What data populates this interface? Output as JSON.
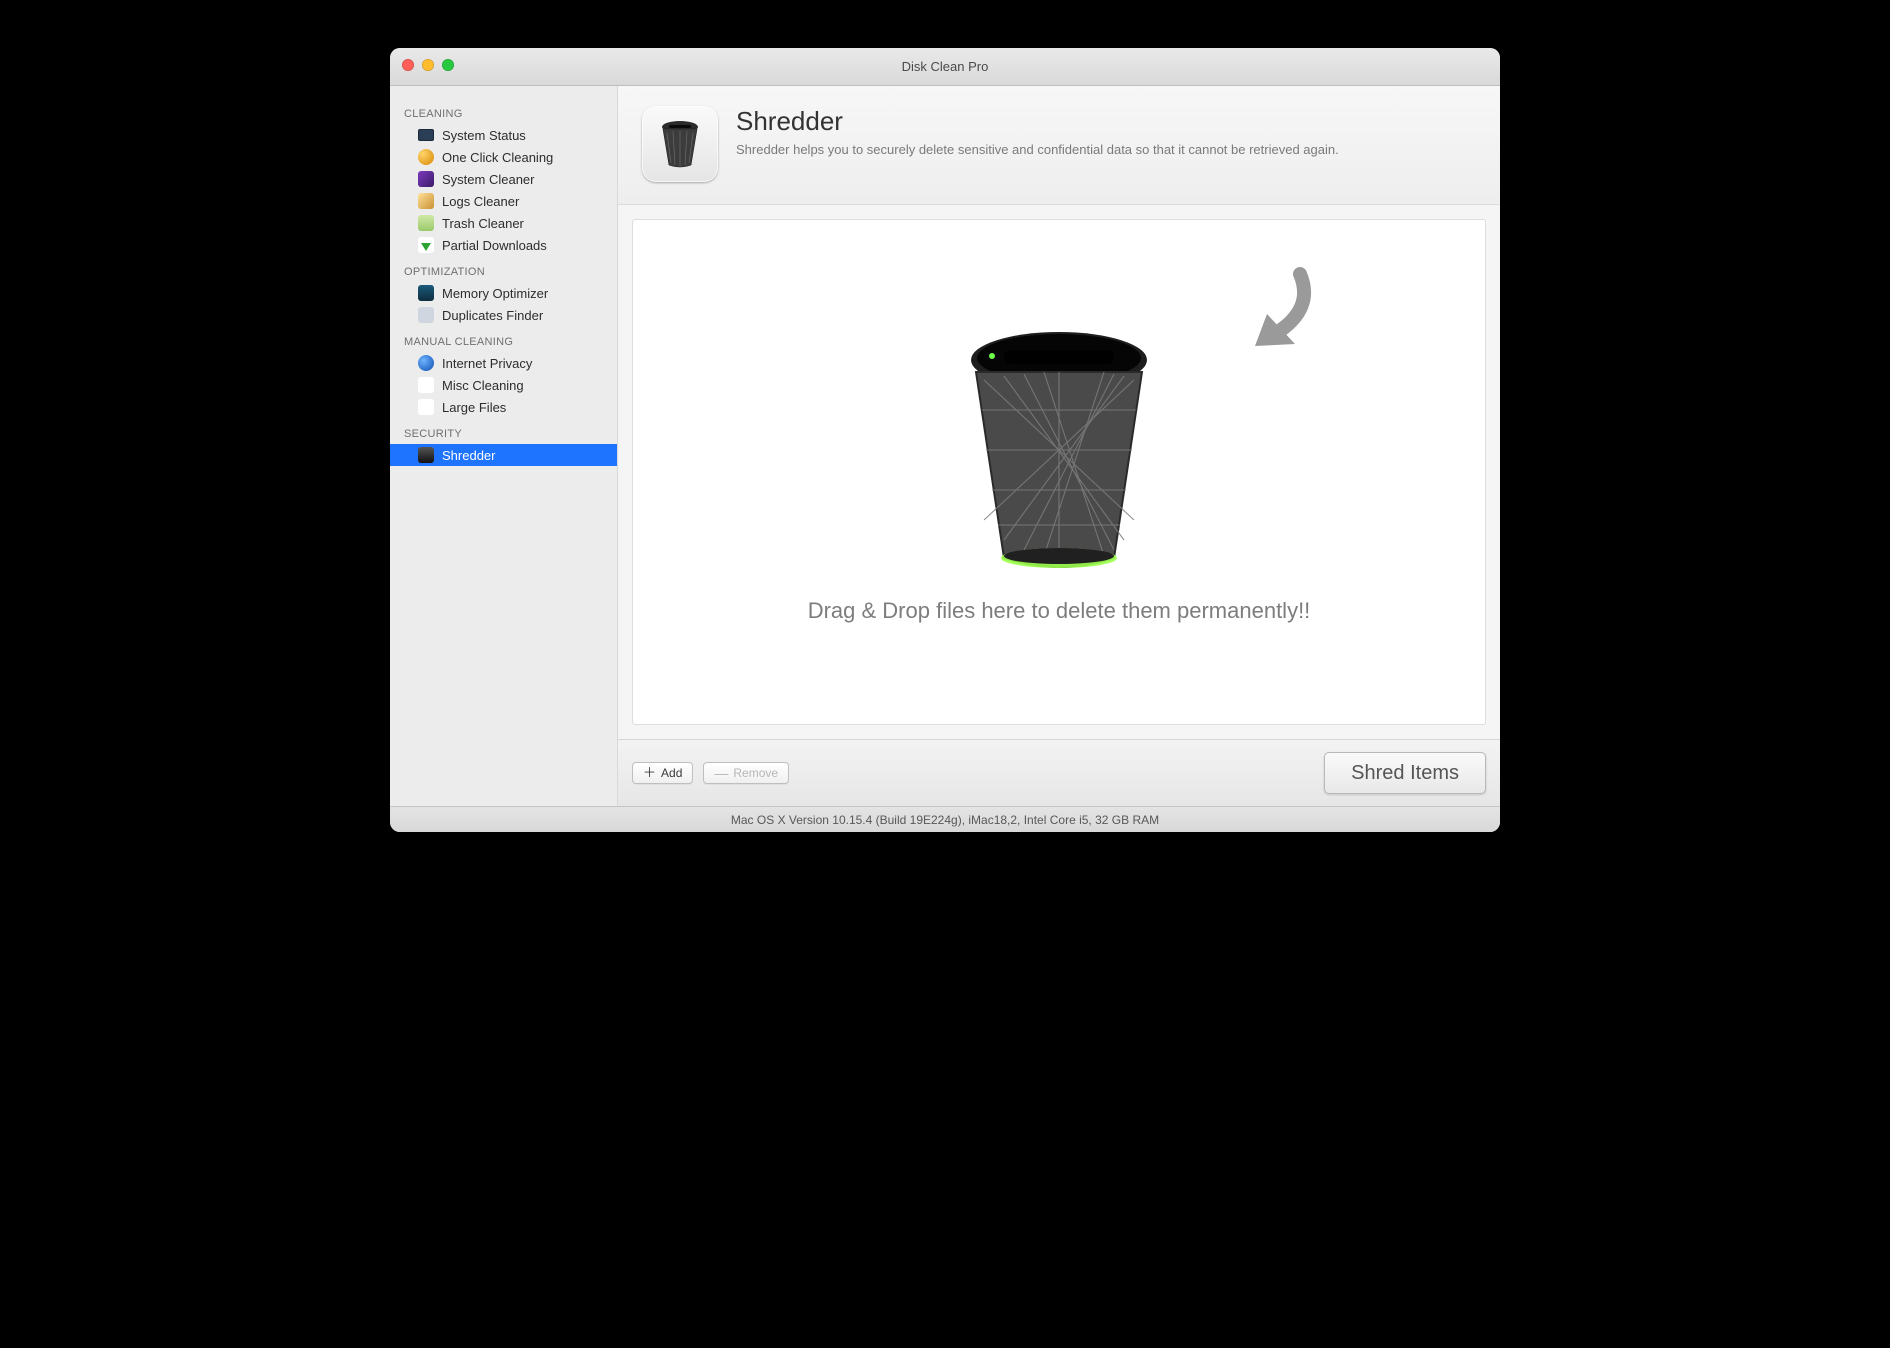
{
  "window": {
    "title": "Disk Clean Pro"
  },
  "sidebar": {
    "sections": [
      {
        "label": "CLEANING",
        "items": [
          {
            "label": "System Status",
            "icon": "monitor-icon"
          },
          {
            "label": "One Click Cleaning",
            "icon": "globe-icon"
          },
          {
            "label": "System Cleaner",
            "icon": "chip-icon"
          },
          {
            "label": "Logs Cleaner",
            "icon": "pencil-icon"
          },
          {
            "label": "Trash Cleaner",
            "icon": "trash-icon"
          },
          {
            "label": "Partial Downloads",
            "icon": "download-icon"
          }
        ]
      },
      {
        "label": "OPTIMIZATION",
        "items": [
          {
            "label": "Memory Optimizer",
            "icon": "memory-icon"
          },
          {
            "label": "Duplicates Finder",
            "icon": "duplicates-icon"
          }
        ]
      },
      {
        "label": "MANUAL CLEANING",
        "items": [
          {
            "label": "Internet Privacy",
            "icon": "earth-icon"
          },
          {
            "label": "Misc Cleaning",
            "icon": "misc-icon"
          },
          {
            "label": "Large Files",
            "icon": "expand-icon"
          }
        ]
      },
      {
        "label": "SECURITY",
        "items": [
          {
            "label": "Shredder",
            "icon": "shredder-icon",
            "selected": true
          }
        ]
      }
    ]
  },
  "page": {
    "title": "Shredder",
    "description": "Shredder helps you to securely delete sensitive and confidential data so that it cannot be retrieved again.",
    "drop_hint": "Drag & Drop files here to delete them permanently!!"
  },
  "footer": {
    "add_label": "Add",
    "remove_label": "Remove",
    "shred_label": "Shred Items"
  },
  "statusbar": {
    "text": "Mac OS X Version 10.15.4 (Build 19E224g), iMac18,2, Intel Core i5, 32 GB RAM"
  }
}
